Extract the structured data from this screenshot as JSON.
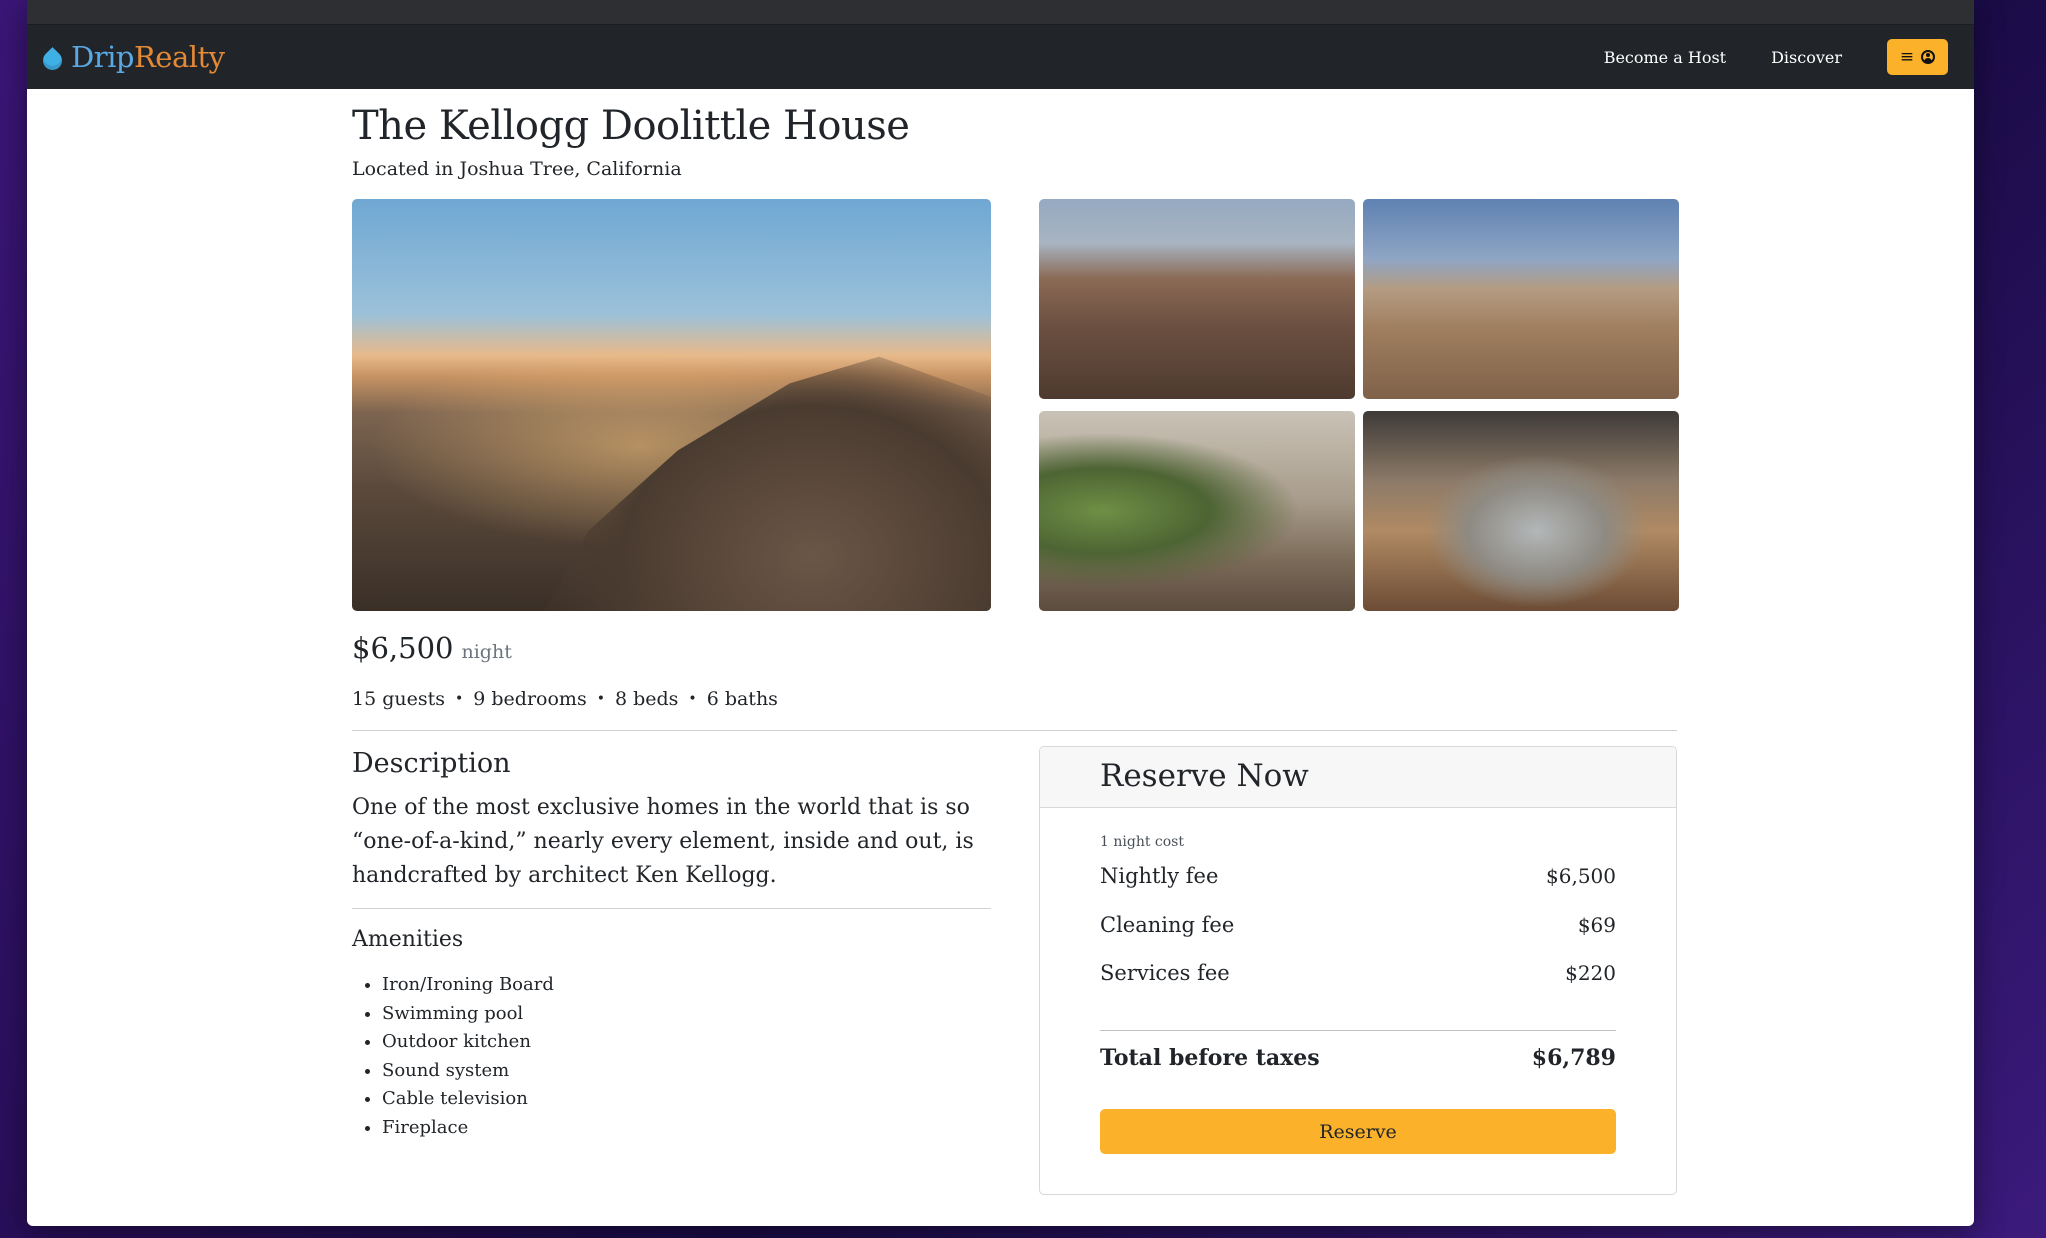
{
  "navbar": {
    "brand_part1": "Drip",
    "brand_part2": "Realty",
    "links": [
      "Become a Host",
      "Discover"
    ],
    "menu_icons": [
      "hamburger-icon",
      "user-circle-icon"
    ]
  },
  "listing": {
    "title": "The Kellogg Doolittle House",
    "location": "Located in Joshua Tree, California",
    "photos": [
      {
        "alt": "Exterior at sunset among boulders"
      },
      {
        "alt": "Aerial view of house in desert"
      },
      {
        "alt": "Patio with dining table"
      },
      {
        "alt": "Living room with plants"
      },
      {
        "alt": "Bedroom with panoramic window"
      }
    ],
    "price": "$6,500",
    "price_unit": "night",
    "specs": [
      "15 guests",
      "9 bedrooms",
      "8 beds",
      "6 baths"
    ],
    "description_heading": "Description",
    "description": "One of the most exclusive homes in the world that is so “one-of-a-kind,” nearly every element, inside and out, is handcrafted by architect Ken Kellogg.",
    "amenities_heading": "Amenities",
    "amenities": [
      "Iron/Ironing Board",
      "Swimming pool",
      "Outdoor kitchen",
      "Sound system",
      "Cable television",
      "Fireplace"
    ]
  },
  "reserve": {
    "title": "Reserve Now",
    "caption": "1 night cost",
    "fees": [
      {
        "label": "Nightly fee",
        "value": "$6,500"
      },
      {
        "label": "Cleaning fee",
        "value": "$69"
      },
      {
        "label": "Services fee",
        "value": "$220"
      }
    ],
    "total_label": "Total before taxes",
    "total_value": "$6,789",
    "button_label": "Reserve"
  },
  "colors": {
    "accent": "#fbb129",
    "navbar_bg": "#212529",
    "brand_blue": "#5aa9e4",
    "brand_orange": "#e48a36"
  }
}
